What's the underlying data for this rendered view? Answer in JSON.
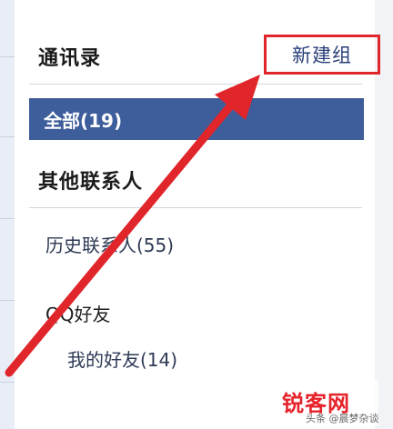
{
  "header": {
    "title": "通讯录",
    "new_group_label": "新建组"
  },
  "groups": {
    "all_label": "全部(19)"
  },
  "sections": {
    "other_contacts_title": "其他联系人",
    "history_contacts": "历史联系人(55)",
    "qq_friends": "QQ好友",
    "my_friends": "我的好友(14)"
  },
  "watermark": {
    "logo_text": "锐客网",
    "sub_text": "头条 @晨梦杂谈"
  },
  "colors": {
    "selected_bg": "#3e5d9b",
    "highlight_red": "#e0262b"
  }
}
